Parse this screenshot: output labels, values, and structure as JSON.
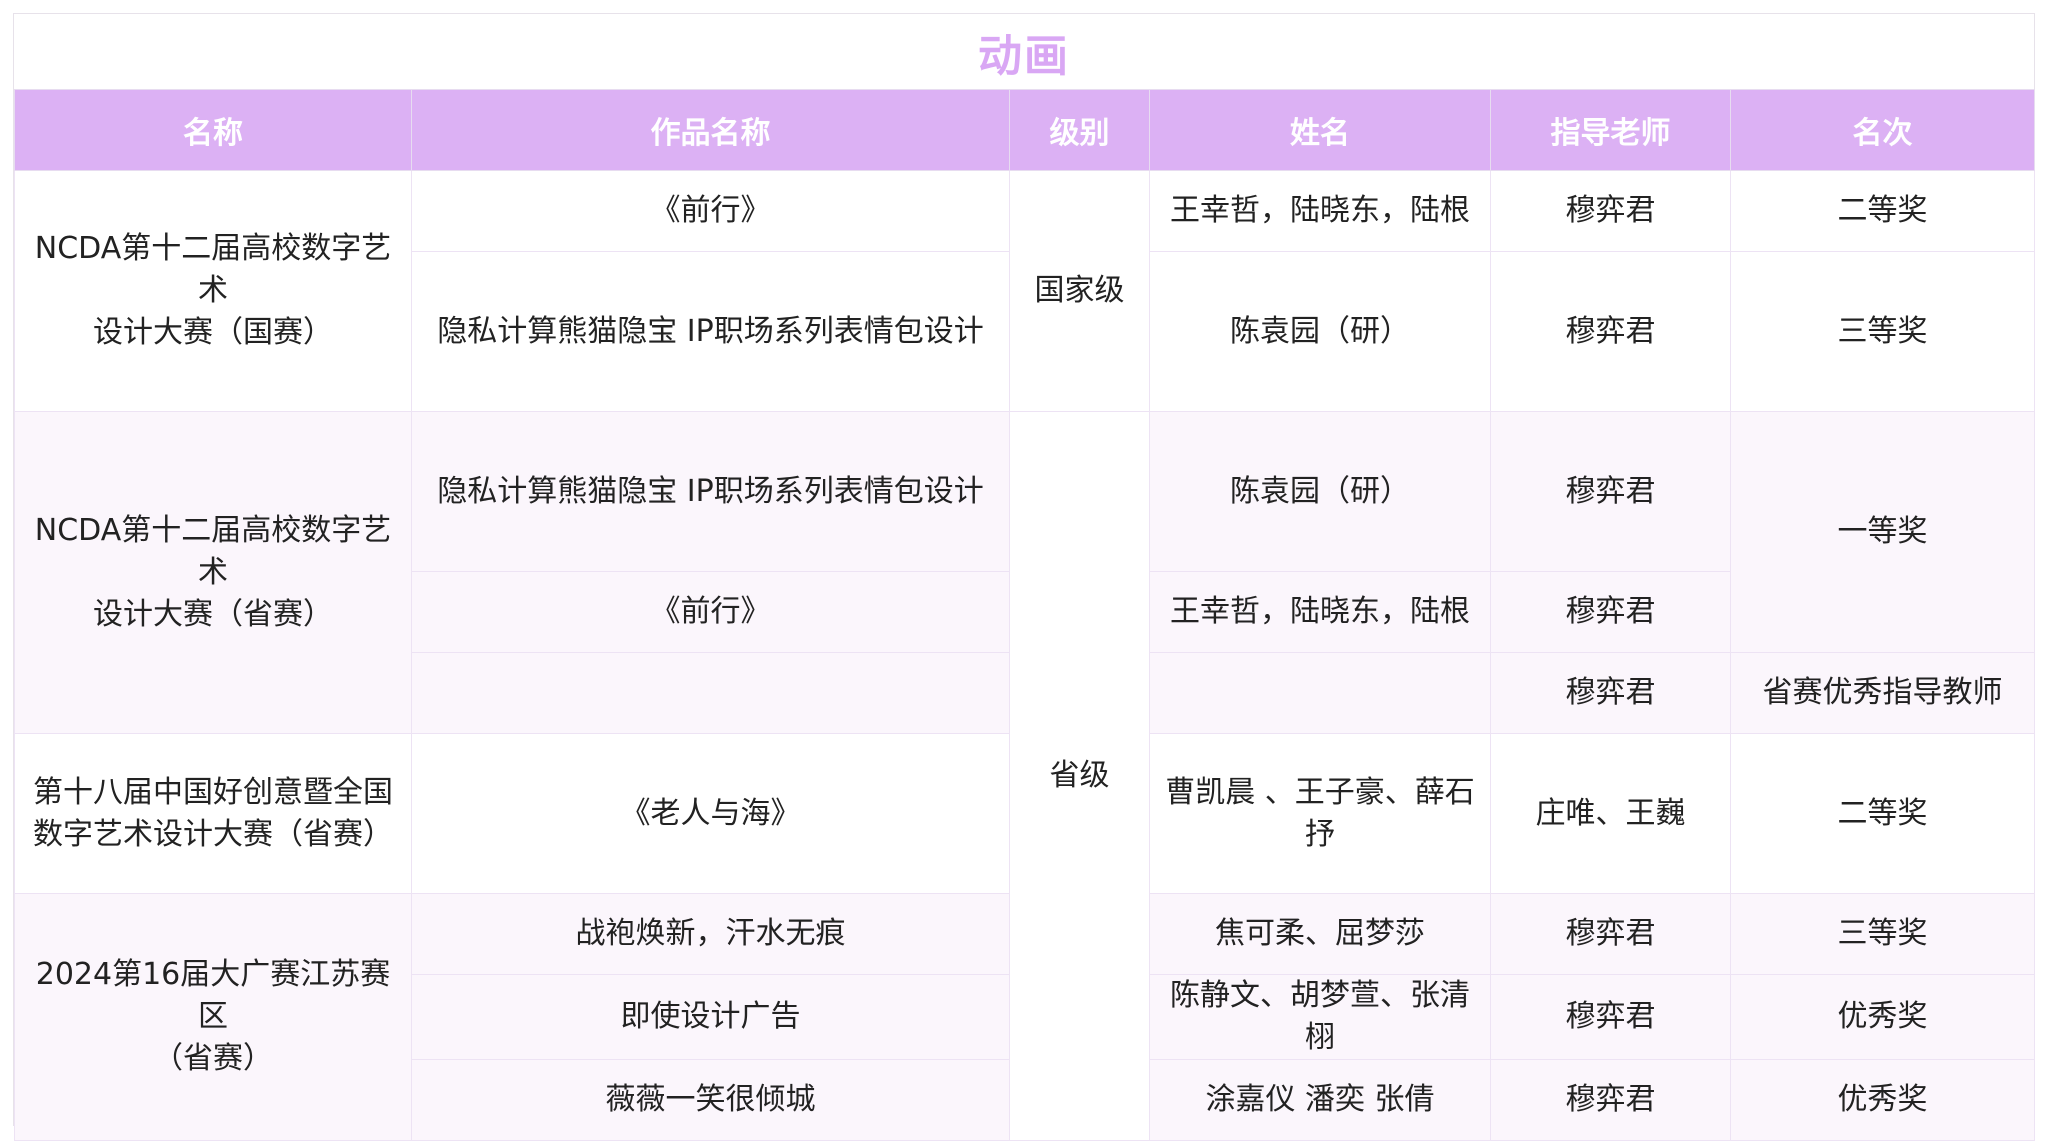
{
  "title": "动画",
  "colors": {
    "title": "#d9a7f4",
    "header_bg": "#dcb1f4",
    "header_text": "#ffffff",
    "border": "#ede3f4",
    "row_shade": "#fbf6fc"
  },
  "headers": [
    "名称",
    "作品名称",
    "级别",
    "姓名",
    "指导老师",
    "名次"
  ],
  "competitions": {
    "c1_line1": "NCDA第十二届高校数字艺术",
    "c1_line2": "设计大赛（国赛）",
    "c2_line1": "NCDA第十二届高校数字艺术",
    "c2_line2": "设计大赛（省赛）",
    "c3_line1": "第十八届中国好创意暨全国",
    "c3_line2": "数字艺术设计大赛（省赛）",
    "c4_line1": "2024第16届大广赛江苏赛区",
    "c4_line2": "（省赛）"
  },
  "levels": {
    "national": "国家级",
    "provincial": "省级"
  },
  "rows": [
    {
      "work": "《前行》",
      "names": "王幸哲，陆晓东，陆根",
      "teacher": "穆弈君",
      "rank": "二等奖"
    },
    {
      "work": "隐私计算熊猫隐宝 IP职场系列表情包设计",
      "names": "陈袁园（研）",
      "teacher": "穆弈君",
      "rank": "三等奖"
    },
    {
      "work": "隐私计算熊猫隐宝 IP职场系列表情包设计",
      "names": "陈袁园（研）",
      "teacher": "穆弈君",
      "rank": "一等奖"
    },
    {
      "work": "《前行》",
      "names": "王幸哲，陆晓东，陆根",
      "teacher": "穆弈君",
      "rank": ""
    },
    {
      "work": "",
      "names": "",
      "teacher": "穆弈君",
      "rank": "省赛优秀指导教师"
    },
    {
      "work": "《老人与海》",
      "names": "曹凯晨 、王子豪、薛石抒",
      "teacher": "庄唯、王巍",
      "rank": "二等奖"
    },
    {
      "work": "战袍焕新，汗水无痕",
      "names": "焦可柔、屈梦莎",
      "teacher": "穆弈君",
      "rank": "三等奖"
    },
    {
      "work": "即使设计广告",
      "names": "陈静文、胡梦萱、张清栩",
      "teacher": "穆弈君",
      "rank": "优秀奖"
    },
    {
      "work": "薇薇一笑很倾城",
      "names": "涂嘉仪 潘奕 张倩",
      "teacher": "穆弈君",
      "rank": "优秀奖"
    }
  ]
}
